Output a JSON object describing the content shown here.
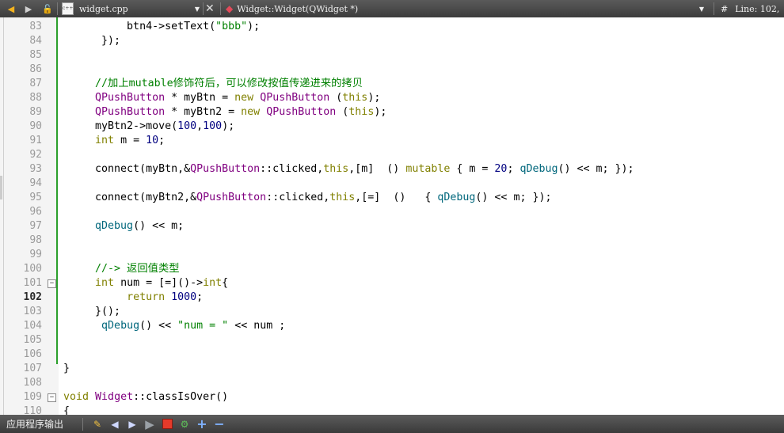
{
  "toolbar": {
    "file_name": "widget.cpp",
    "file_icon_text": "c++",
    "symbol_name": "Widget::Widget(QWidget *)",
    "line_label": "Line: 102,"
  },
  "editor": {
    "lines": [
      {
        "n": "83",
        "current": false,
        "fold": "",
        "changed": true,
        "html": "          btn4-&gt;setText(<span class=\"str\">\"bbb\"</span>);"
      },
      {
        "n": "84",
        "current": false,
        "fold": "",
        "changed": true,
        "html": "      });"
      },
      {
        "n": "85",
        "current": false,
        "fold": "",
        "changed": true,
        "html": ""
      },
      {
        "n": "86",
        "current": false,
        "fold": "",
        "changed": true,
        "html": ""
      },
      {
        "n": "87",
        "current": false,
        "fold": "",
        "changed": true,
        "html": "     <span class=\"cm\">//加上mutable修饰符后，可以修改按值传递进来的拷贝</span>"
      },
      {
        "n": "88",
        "current": false,
        "fold": "",
        "changed": true,
        "html": "     <span class=\"ty\">QPushButton</span> * myBtn = <span class=\"kw\">new</span> <span class=\"ty\">QPushButton</span> (<span class=\"kw\">this</span>);"
      },
      {
        "n": "89",
        "current": false,
        "fold": "",
        "changed": true,
        "html": "     <span class=\"ty\">QPushButton</span> * myBtn2 = <span class=\"kw\">new</span> <span class=\"ty\">QPushButton</span> (<span class=\"kw\">this</span>);"
      },
      {
        "n": "90",
        "current": false,
        "fold": "",
        "changed": true,
        "html": "     myBtn2-&gt;move(<span class=\"num\">100</span>,<span class=\"num\">100</span>);"
      },
      {
        "n": "91",
        "current": false,
        "fold": "",
        "changed": true,
        "html": "     <span class=\"kw\">int</span> m = <span class=\"num\">10</span>;"
      },
      {
        "n": "92",
        "current": false,
        "fold": "",
        "changed": true,
        "html": ""
      },
      {
        "n": "93",
        "current": false,
        "fold": "",
        "changed": true,
        "html": "     connect(myBtn,&amp;<span class=\"ty\">QPushButton</span>::clicked,<span class=\"kw\">this</span>,[m]  () <span class=\"kw\">mutable</span> { m = <span class=\"num\">20</span>; <span class=\"fn\">qDebug</span>() &lt;&lt; m; });"
      },
      {
        "n": "94",
        "current": false,
        "fold": "",
        "changed": true,
        "html": ""
      },
      {
        "n": "95",
        "current": false,
        "fold": "",
        "changed": true,
        "html": "     connect(myBtn2,&amp;<span class=\"ty\">QPushButton</span>::clicked,<span class=\"kw\">this</span>,[=]  ()   { <span class=\"fn\">qDebug</span>() &lt;&lt; m; });"
      },
      {
        "n": "96",
        "current": false,
        "fold": "",
        "changed": true,
        "html": ""
      },
      {
        "n": "97",
        "current": false,
        "fold": "",
        "changed": true,
        "html": "     <span class=\"fn\">qDebug</span>() &lt;&lt; m;"
      },
      {
        "n": "98",
        "current": false,
        "fold": "",
        "changed": true,
        "html": ""
      },
      {
        "n": "99",
        "current": false,
        "fold": "",
        "changed": true,
        "html": ""
      },
      {
        "n": "100",
        "current": false,
        "fold": "",
        "changed": true,
        "html": "     <span class=\"cm\">//-&gt; 返回值类型</span>"
      },
      {
        "n": "101",
        "current": false,
        "fold": "−",
        "changed": true,
        "html": "     <span class=\"kw\">int</span> num = [=]()-&gt;<span class=\"kw\">int</span>{"
      },
      {
        "n": "102",
        "current": true,
        "fold": "",
        "changed": true,
        "html": "          <span class=\"kw\">return</span> <span class=\"num\">1000</span>;"
      },
      {
        "n": "103",
        "current": false,
        "fold": "",
        "changed": true,
        "html": "     }();"
      },
      {
        "n": "104",
        "current": false,
        "fold": "",
        "changed": true,
        "html": "      <span class=\"fn\">qDebug</span>() &lt;&lt; <span class=\"str\">\"num = \"</span> &lt;&lt; num ;"
      },
      {
        "n": "105",
        "current": false,
        "fold": "",
        "changed": true,
        "html": ""
      },
      {
        "n": "106",
        "current": false,
        "fold": "",
        "changed": true,
        "html": ""
      },
      {
        "n": "107",
        "current": false,
        "fold": "",
        "changed": false,
        "html": "}"
      },
      {
        "n": "108",
        "current": false,
        "fold": "",
        "changed": false,
        "html": ""
      },
      {
        "n": "109",
        "current": false,
        "fold": "−",
        "changed": false,
        "html": "<span class=\"kw\">void</span> <span class=\"ty\">Widget</span>::classIsOver()"
      },
      {
        "n": "110",
        "current": false,
        "fold": "",
        "changed": false,
        "html": "{"
      }
    ]
  },
  "statusbar": {
    "output_label": "应用程序输出"
  },
  "colors": {
    "keyword": "#808000",
    "type": "#800080",
    "function": "#00677c",
    "string": "#008000",
    "change_bar": "#2ca02c"
  }
}
